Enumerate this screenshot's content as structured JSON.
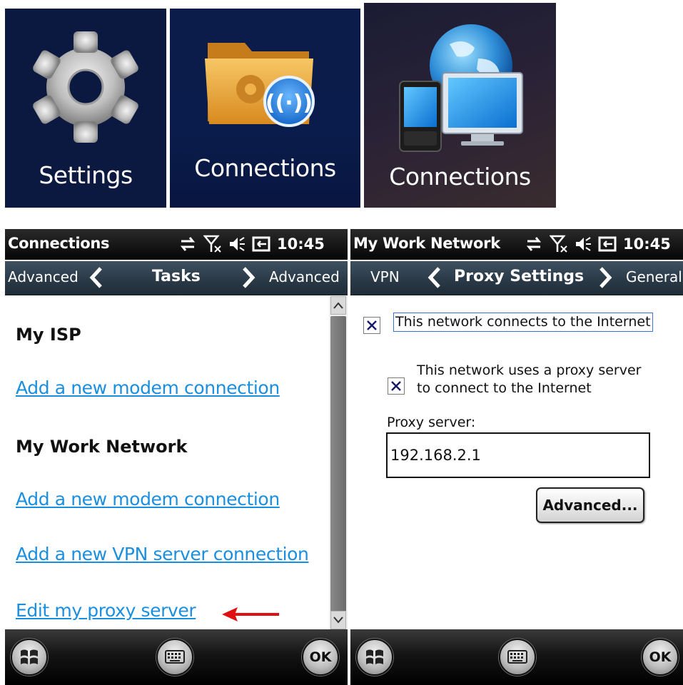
{
  "tiles": [
    {
      "label": "Settings",
      "icon": "gear-icon"
    },
    {
      "label": "Connections",
      "icon": "folder-wireless-icon"
    },
    {
      "label": "Connections",
      "icon": "globe-devices-icon"
    }
  ],
  "left_screen": {
    "status_title": "Connections",
    "time": "10:45",
    "nav": {
      "prev": "Advanced",
      "title": "Tasks",
      "next": "Advanced"
    },
    "sections": [
      {
        "heading": "My ISP",
        "links": [
          "Add a new modem connection"
        ]
      },
      {
        "heading": "My Work Network",
        "links": [
          "Add a new modem connection",
          "Add a new VPN server connection",
          "Edit my proxy server"
        ]
      }
    ],
    "highlight_arrow_color": "#e01010"
  },
  "right_screen": {
    "status_title": "My Work Network",
    "time": "10:45",
    "nav": {
      "prev": "VPN",
      "title": "Proxy Settings",
      "next": "General"
    },
    "checkbox_internet": {
      "label": "This network connects to the Internet",
      "checked": true
    },
    "checkbox_proxy": {
      "label_line1": "This network uses a proxy server",
      "label_line2": "to connect to the Internet",
      "checked": true
    },
    "proxy_label": "Proxy server:",
    "proxy_value": "192.168.2.1",
    "advanced_button": "Advanced..."
  },
  "taskbar": {
    "start_icon": "windows-logo-icon",
    "keyboard_icon": "keyboard-icon",
    "ok_label": "OK"
  },
  "colors": {
    "link": "#1a8fe0",
    "arrow": "#e01010",
    "tile_bg": "#0b1940"
  }
}
